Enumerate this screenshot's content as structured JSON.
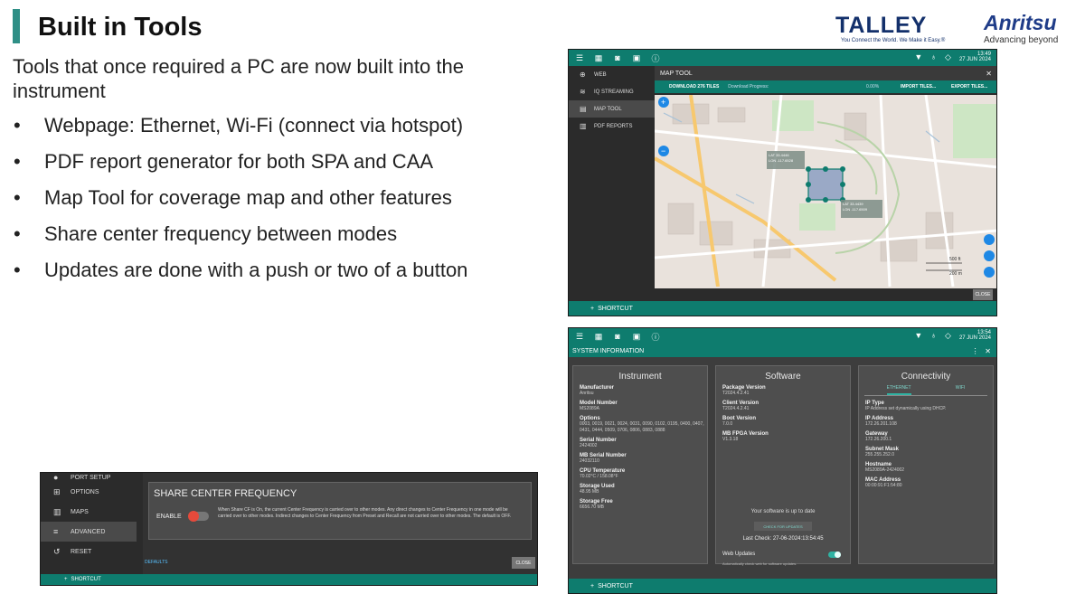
{
  "slide": {
    "title": "Built in Tools",
    "intro": "Tools that once required a PC are now built into the instrument",
    "bullets": [
      "Webpage: Ethernet, Wi-Fi (connect via hotspot)",
      "PDF report generator for both SPA and CAA",
      "Map Tool for coverage map and other features",
      "Share center frequency between modes",
      "Updates are done with a push or two of a button"
    ]
  },
  "logos": {
    "talley": "TALLEY",
    "talley_tagline": "You Connect the World. We Make it Easy.®",
    "anritsu": "Anritsu",
    "anritsu_tagline": "Advancing beyond"
  },
  "map_tool": {
    "time": "13:49",
    "date": "27 JUN 2024",
    "sidebar": [
      {
        "label": "WEB",
        "icon": "globe-icon"
      },
      {
        "label": "IQ STREAMING",
        "icon": "stream-icon"
      },
      {
        "label": "MAP TOOL",
        "icon": "map-icon"
      },
      {
        "label": "PDF REPORTS",
        "icon": "pdf-icon"
      }
    ],
    "header": "MAP TOOL",
    "download_label": "DOWNLOAD 276 TILES",
    "download_progress_label": "Download Progress:",
    "download_percent": "0.00%",
    "import_label": "IMPORT TILES...",
    "export_label": "EXPORT TILES...",
    "marker1": "LAT 33.4446\nLON -117.6528",
    "marker2": "LAT 33.4439\nLON -117.6509",
    "scale_top": "500 ft",
    "scale_bottom": "200 m",
    "close_label": "CLOSE",
    "shortcut_label": "SHORTCUT",
    "colors": {
      "toolbar": "#0e7c6e",
      "map_bg": "#e9e2dc",
      "zone": "#9aa9c6"
    }
  },
  "system_info": {
    "time": "13:54",
    "date": "27 JUN 2024",
    "header": "SYSTEM INFORMATION",
    "instrument": {
      "title": "Instrument",
      "fields": [
        {
          "key": "Manufacturer",
          "value": "Anritsu"
        },
        {
          "key": "Model Number",
          "value": "MS2089A"
        },
        {
          "key": "Options",
          "value": "0003, 0019, 0021, 0024, 0031, 0090, 0102, 0195, 0400, 0407, 0431, 0444, 0509, 0706, 0806, 0883, 0888"
        },
        {
          "key": "Serial Number",
          "value": "2424002"
        },
        {
          "key": "MB Serial Number",
          "value": "24032110"
        },
        {
          "key": "CPU Temperature",
          "value": "70.02°C / 158.08°F"
        },
        {
          "key": "Storage Used",
          "value": "48.95 MB"
        },
        {
          "key": "Storage Free",
          "value": "6656.70 MB"
        }
      ]
    },
    "software": {
      "title": "Software",
      "fields": [
        {
          "key": "Package Version",
          "value": "T2024.4.2.41"
        },
        {
          "key": "Client Version",
          "value": "T2024.4.2.41"
        },
        {
          "key": "Boot Version",
          "value": "7.0.0"
        },
        {
          "key": "MB FPGA Version",
          "value": "V1.3.18"
        }
      ],
      "status": "Your software is up to date",
      "check_button": "CHECK FOR UPDATES",
      "last_check": "Last Check: 27-06-2024:13:54:45",
      "web_updates_label": "Web Updates",
      "web_updates_note": "Automatically check web for software updates."
    },
    "connectivity": {
      "title": "Connectivity",
      "tabs": [
        "ETHERNET",
        "WIFI"
      ],
      "fields": [
        {
          "key": "IP Type",
          "value": "IP Address set dynamically using DHCP."
        },
        {
          "key": "IP Address",
          "value": "172.26.201.108"
        },
        {
          "key": "Gateway",
          "value": "172.26.200.1"
        },
        {
          "key": "Subnet Mask",
          "value": "255.255.252.0"
        },
        {
          "key": "Hostname",
          "value": "MS2089A-2424002"
        },
        {
          "key": "MAC Address",
          "value": "00:00:91:F1:54:80"
        }
      ]
    },
    "shortcut_label": "SHORTCUT"
  },
  "share_cf": {
    "sidebar": [
      {
        "label": "PORT SETUP",
        "icon": "port-icon"
      },
      {
        "label": "OPTIONS",
        "icon": "cart-icon"
      },
      {
        "label": "MAPS",
        "icon": "map-icon"
      },
      {
        "label": "ADVANCED",
        "icon": "tune-icon"
      },
      {
        "label": "RESET",
        "icon": "reset-icon"
      }
    ],
    "title": "SHARE CENTER FREQUENCY",
    "enable_label": "ENABLE",
    "description": "When Share CF is On, the current Center Frequency is carried over to other modes. Any direct changes to Center Frequency in one mode will be carried over to other modes. Indirect changes to Center Frequency from Preset and Recall are not carried over to other modes. The default is OFF.",
    "defaults_label": "DEFAULTS",
    "close_label": "CLOSE",
    "shortcut_label": "SHORTCUT"
  }
}
